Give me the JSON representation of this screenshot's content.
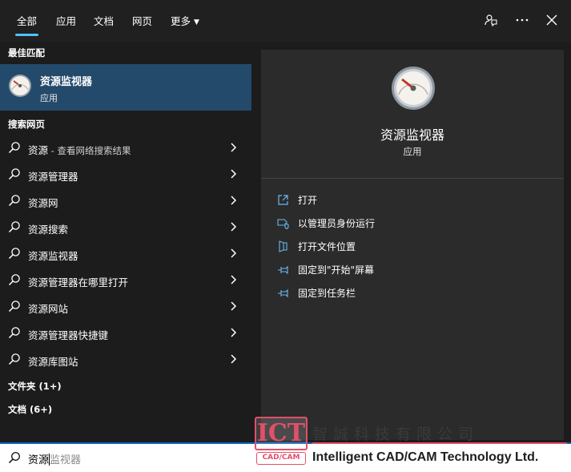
{
  "tabs": [
    {
      "label": "全部",
      "active": true
    },
    {
      "label": "应用"
    },
    {
      "label": "文档"
    },
    {
      "label": "网页"
    },
    {
      "label": "更多"
    }
  ],
  "top_icons": [
    "feedback-icon",
    "more-icon",
    "close-icon"
  ],
  "sections": {
    "best_match": "最佳匹配",
    "web_search": "搜索网页",
    "folders": "文件夹 (1+)",
    "documents": "文档 (6+)"
  },
  "best_match": {
    "name": "资源监视器",
    "type": "应用",
    "icon": "resource-monitor-icon"
  },
  "web_results": [
    {
      "text": "资源",
      "suffix": " - 查看网络搜索结果"
    },
    {
      "text": "资源管理器"
    },
    {
      "text": "资源网"
    },
    {
      "text": "资源搜索"
    },
    {
      "text": "资源监视器"
    },
    {
      "text": "资源管理器在哪里打开"
    },
    {
      "text": "资源网站"
    },
    {
      "text": "资源管理器快捷键"
    },
    {
      "text": "资源库图站"
    }
  ],
  "detail": {
    "name": "资源监视器",
    "type": "应用"
  },
  "actions": [
    {
      "label": "打开",
      "icon": "open-icon"
    },
    {
      "label": "以管理员身份运行",
      "icon": "shield-icon"
    },
    {
      "label": "打开文件位置",
      "icon": "folder-icon"
    },
    {
      "label": "固定到\"开始\"屏幕",
      "icon": "pin-icon"
    },
    {
      "label": "固定到任务栏",
      "icon": "pin-icon"
    }
  ],
  "search": {
    "typed": "资源",
    "suggestion": "监视器"
  },
  "watermark": {
    "logo": "ICT",
    "tag": "CAD/CAM",
    "company_cn": "智誠科技有限公司",
    "company_en": "Intelligent CAD/CAM Technology Ltd."
  },
  "colors": {
    "accent": "#4cc2ff",
    "selected": "#234a6b",
    "watermark": "#e0506a"
  }
}
